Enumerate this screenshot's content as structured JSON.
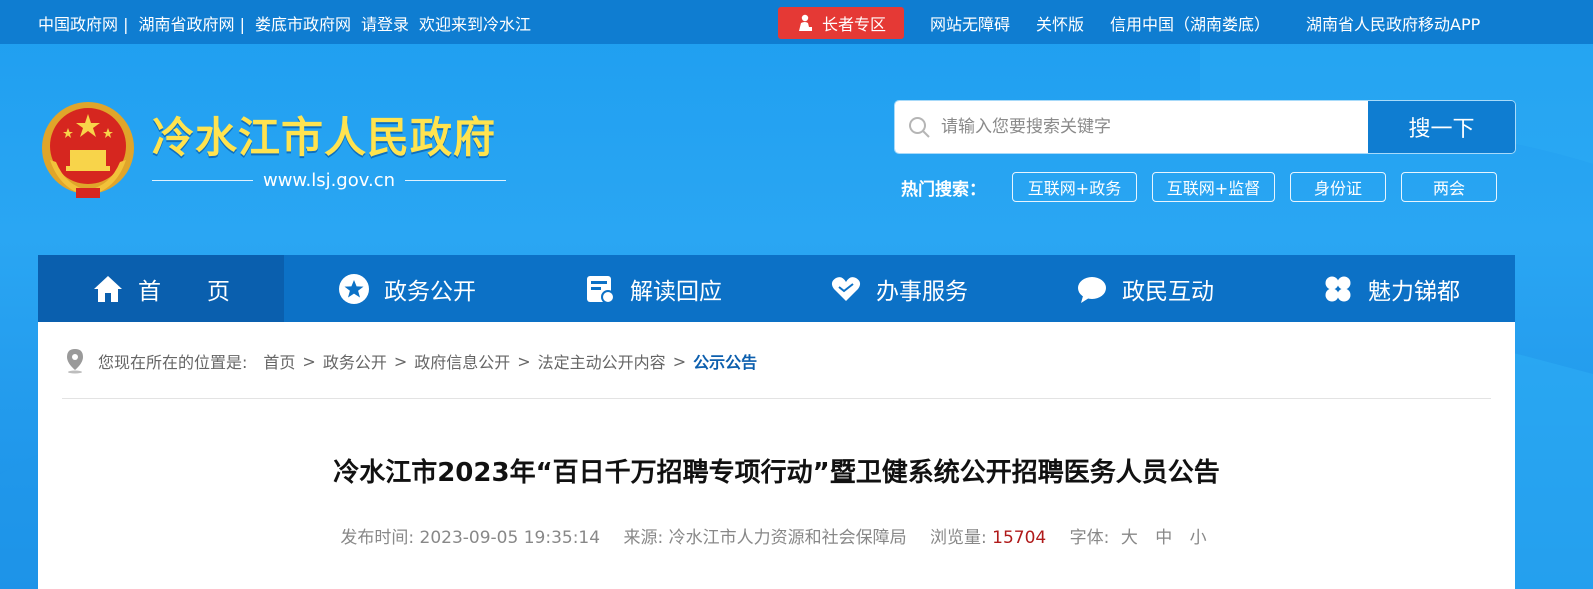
{
  "topbar": {
    "links": [
      "中国政府网 |",
      "湖南省政府网 |",
      "娄底市政府网",
      "请登录",
      "欢迎来到冷水江"
    ],
    "elder_label": "长者专区",
    "right_links": [
      "网站无障碍",
      "关怀版",
      "信用中国（湖南娄底）"
    ],
    "app_link": "湖南省人民政府移动APP"
  },
  "header": {
    "title": "冷水江市人民政府",
    "url": "www.lsj.gov.cn"
  },
  "search": {
    "placeholder": "请输入您要搜索关键字",
    "button": "搜一下",
    "hot_label": "热门搜索：",
    "hot_tags": [
      "互联网+政务",
      "互联网+监督",
      "身份证",
      "两会"
    ]
  },
  "nav": {
    "items": [
      "首　　页",
      "政务公开",
      "解读回应",
      "办事服务",
      "政民互动",
      "魅力锑都"
    ]
  },
  "breadcrumb": {
    "prefix": "您现在所在的位置是:",
    "items": [
      "首页",
      "政务公开",
      "政府信息公开",
      "法定主动公开内容"
    ],
    "current": "公示公告"
  },
  "article": {
    "title": "冷水江市2023年“百日千万招聘专项行动”暨卫健系统公开招聘医务人员公告",
    "publish_label": "发布时间:",
    "publish_time": "2023-09-05 19:35:14",
    "source_label": "来源:",
    "source": "冷水江市人力资源和社会保障局",
    "views_label": "浏览量:",
    "views": "15704",
    "font_label": "字体:",
    "font_sizes": [
      "大",
      "中",
      "小"
    ]
  },
  "colors": {
    "topbar": "#0f7dd1",
    "nav": "#0c71c6",
    "title_yellow": "#ffe34f",
    "elder_red": "#e53935",
    "views_red": "#b01a1a"
  }
}
